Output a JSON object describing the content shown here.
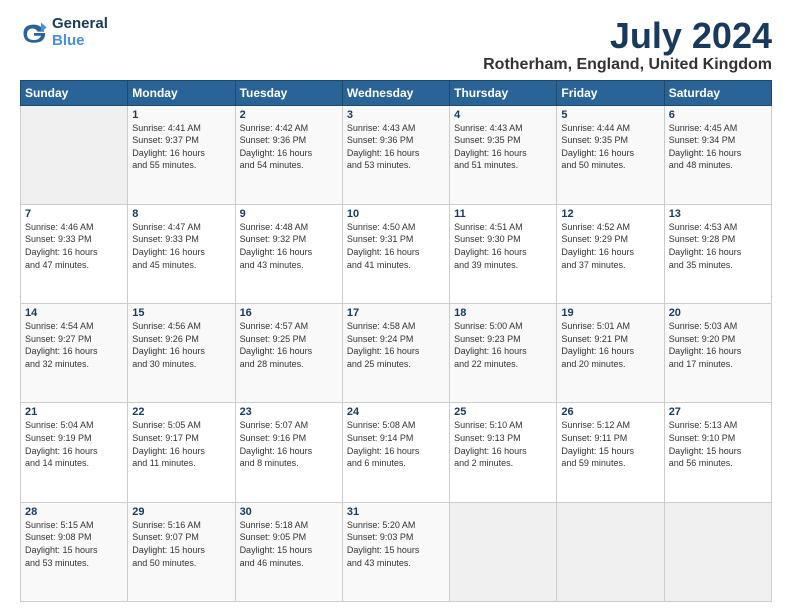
{
  "logo": {
    "line1": "General",
    "line2": "Blue",
    "icon": "▶"
  },
  "title": "July 2024",
  "subtitle": "Rotherham, England, United Kingdom",
  "days_of_week": [
    "Sunday",
    "Monday",
    "Tuesday",
    "Wednesday",
    "Thursday",
    "Friday",
    "Saturday"
  ],
  "weeks": [
    [
      {
        "day": "",
        "info": ""
      },
      {
        "day": "1",
        "info": "Sunrise: 4:41 AM\nSunset: 9:37 PM\nDaylight: 16 hours\nand 55 minutes."
      },
      {
        "day": "2",
        "info": "Sunrise: 4:42 AM\nSunset: 9:36 PM\nDaylight: 16 hours\nand 54 minutes."
      },
      {
        "day": "3",
        "info": "Sunrise: 4:43 AM\nSunset: 9:36 PM\nDaylight: 16 hours\nand 53 minutes."
      },
      {
        "day": "4",
        "info": "Sunrise: 4:43 AM\nSunset: 9:35 PM\nDaylight: 16 hours\nand 51 minutes."
      },
      {
        "day": "5",
        "info": "Sunrise: 4:44 AM\nSunset: 9:35 PM\nDaylight: 16 hours\nand 50 minutes."
      },
      {
        "day": "6",
        "info": "Sunrise: 4:45 AM\nSunset: 9:34 PM\nDaylight: 16 hours\nand 48 minutes."
      }
    ],
    [
      {
        "day": "7",
        "info": "Sunrise: 4:46 AM\nSunset: 9:33 PM\nDaylight: 16 hours\nand 47 minutes."
      },
      {
        "day": "8",
        "info": "Sunrise: 4:47 AM\nSunset: 9:33 PM\nDaylight: 16 hours\nand 45 minutes."
      },
      {
        "day": "9",
        "info": "Sunrise: 4:48 AM\nSunset: 9:32 PM\nDaylight: 16 hours\nand 43 minutes."
      },
      {
        "day": "10",
        "info": "Sunrise: 4:50 AM\nSunset: 9:31 PM\nDaylight: 16 hours\nand 41 minutes."
      },
      {
        "day": "11",
        "info": "Sunrise: 4:51 AM\nSunset: 9:30 PM\nDaylight: 16 hours\nand 39 minutes."
      },
      {
        "day": "12",
        "info": "Sunrise: 4:52 AM\nSunset: 9:29 PM\nDaylight: 16 hours\nand 37 minutes."
      },
      {
        "day": "13",
        "info": "Sunrise: 4:53 AM\nSunset: 9:28 PM\nDaylight: 16 hours\nand 35 minutes."
      }
    ],
    [
      {
        "day": "14",
        "info": "Sunrise: 4:54 AM\nSunset: 9:27 PM\nDaylight: 16 hours\nand 32 minutes."
      },
      {
        "day": "15",
        "info": "Sunrise: 4:56 AM\nSunset: 9:26 PM\nDaylight: 16 hours\nand 30 minutes."
      },
      {
        "day": "16",
        "info": "Sunrise: 4:57 AM\nSunset: 9:25 PM\nDaylight: 16 hours\nand 28 minutes."
      },
      {
        "day": "17",
        "info": "Sunrise: 4:58 AM\nSunset: 9:24 PM\nDaylight: 16 hours\nand 25 minutes."
      },
      {
        "day": "18",
        "info": "Sunrise: 5:00 AM\nSunset: 9:23 PM\nDaylight: 16 hours\nand 22 minutes."
      },
      {
        "day": "19",
        "info": "Sunrise: 5:01 AM\nSunset: 9:21 PM\nDaylight: 16 hours\nand 20 minutes."
      },
      {
        "day": "20",
        "info": "Sunrise: 5:03 AM\nSunset: 9:20 PM\nDaylight: 16 hours\nand 17 minutes."
      }
    ],
    [
      {
        "day": "21",
        "info": "Sunrise: 5:04 AM\nSunset: 9:19 PM\nDaylight: 16 hours\nand 14 minutes."
      },
      {
        "day": "22",
        "info": "Sunrise: 5:05 AM\nSunset: 9:17 PM\nDaylight: 16 hours\nand 11 minutes."
      },
      {
        "day": "23",
        "info": "Sunrise: 5:07 AM\nSunset: 9:16 PM\nDaylight: 16 hours\nand 8 minutes."
      },
      {
        "day": "24",
        "info": "Sunrise: 5:08 AM\nSunset: 9:14 PM\nDaylight: 16 hours\nand 6 minutes."
      },
      {
        "day": "25",
        "info": "Sunrise: 5:10 AM\nSunset: 9:13 PM\nDaylight: 16 hours\nand 2 minutes."
      },
      {
        "day": "26",
        "info": "Sunrise: 5:12 AM\nSunset: 9:11 PM\nDaylight: 15 hours\nand 59 minutes."
      },
      {
        "day": "27",
        "info": "Sunrise: 5:13 AM\nSunset: 9:10 PM\nDaylight: 15 hours\nand 56 minutes."
      }
    ],
    [
      {
        "day": "28",
        "info": "Sunrise: 5:15 AM\nSunset: 9:08 PM\nDaylight: 15 hours\nand 53 minutes."
      },
      {
        "day": "29",
        "info": "Sunrise: 5:16 AM\nSunset: 9:07 PM\nDaylight: 15 hours\nand 50 minutes."
      },
      {
        "day": "30",
        "info": "Sunrise: 5:18 AM\nSunset: 9:05 PM\nDaylight: 15 hours\nand 46 minutes."
      },
      {
        "day": "31",
        "info": "Sunrise: 5:20 AM\nSunset: 9:03 PM\nDaylight: 15 hours\nand 43 minutes."
      },
      {
        "day": "",
        "info": ""
      },
      {
        "day": "",
        "info": ""
      },
      {
        "day": "",
        "info": ""
      }
    ]
  ]
}
